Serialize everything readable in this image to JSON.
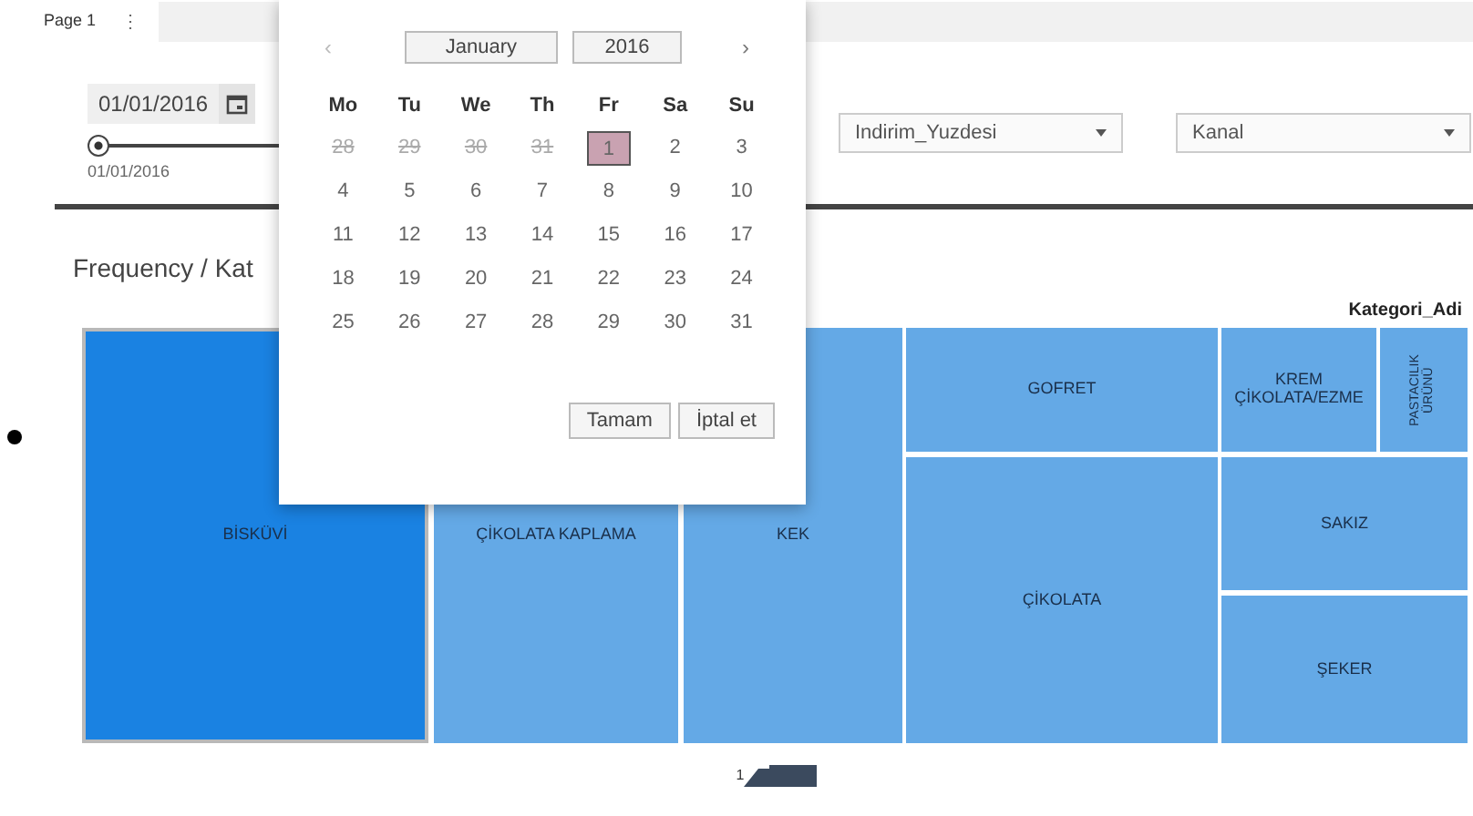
{
  "page_tab": {
    "label": "Page 1",
    "menu": "⋮"
  },
  "date_filter": {
    "value": "01/01/2016",
    "slider_label": "01/01/2016",
    "level": 0
  },
  "dropdowns": [
    {
      "value": "Indirim_Yuzdesi"
    },
    {
      "value": "Kanal"
    }
  ],
  "chart_title": "Frequency / Kat",
  "legend_title": "Kategori_Adi",
  "treemap": [
    {
      "label": "BİSKÜVİ",
      "selected": true
    },
    {
      "label": "ÇİKOLATA KAPLAMA",
      "selected": false
    },
    {
      "label": "KEK",
      "selected": false
    },
    {
      "label": "GOFRET",
      "selected": false
    },
    {
      "label": "ÇİKOLATA",
      "selected": false
    },
    {
      "label": "KREM ÇİKOLATA/EZME",
      "selected": false
    },
    {
      "label": "PASTACILIK ÜRÜNÜ",
      "selected": false,
      "vertical": true
    },
    {
      "label": "SAKIZ",
      "selected": false
    },
    {
      "label": "ŞEKER",
      "selected": false
    }
  ],
  "page_number": "1",
  "calendar": {
    "prev": "‹",
    "next": "›",
    "month": "January",
    "year": "2016",
    "weekdays": [
      "Mo",
      "Tu",
      "We",
      "Th",
      "Fr",
      "Sa",
      "Su"
    ],
    "weeks": [
      [
        {
          "day": "28",
          "outside": true,
          "selected": false
        },
        {
          "day": "29",
          "outside": true,
          "selected": false
        },
        {
          "day": "30",
          "outside": true,
          "selected": false
        },
        {
          "day": "31",
          "outside": true,
          "selected": false
        },
        {
          "day": "1",
          "outside": false,
          "selected": true
        },
        {
          "day": "2",
          "outside": false,
          "selected": false
        },
        {
          "day": "3",
          "outside": false,
          "selected": false
        }
      ],
      [
        {
          "day": "4",
          "outside": false,
          "selected": false
        },
        {
          "day": "5",
          "outside": false,
          "selected": false
        },
        {
          "day": "6",
          "outside": false,
          "selected": false
        },
        {
          "day": "7",
          "outside": false,
          "selected": false
        },
        {
          "day": "8",
          "outside": false,
          "selected": false
        },
        {
          "day": "9",
          "outside": false,
          "selected": false
        },
        {
          "day": "10",
          "outside": false,
          "selected": false
        }
      ],
      [
        {
          "day": "11",
          "outside": false,
          "selected": false
        },
        {
          "day": "12",
          "outside": false,
          "selected": false
        },
        {
          "day": "13",
          "outside": false,
          "selected": false
        },
        {
          "day": "14",
          "outside": false,
          "selected": false
        },
        {
          "day": "15",
          "outside": false,
          "selected": false
        },
        {
          "day": "16",
          "outside": false,
          "selected": false
        },
        {
          "day": "17",
          "outside": false,
          "selected": false
        }
      ],
      [
        {
          "day": "18",
          "outside": false,
          "selected": false
        },
        {
          "day": "19",
          "outside": false,
          "selected": false
        },
        {
          "day": "20",
          "outside": false,
          "selected": false
        },
        {
          "day": "21",
          "outside": false,
          "selected": false
        },
        {
          "day": "22",
          "outside": false,
          "selected": false
        },
        {
          "day": "23",
          "outside": false,
          "selected": false
        },
        {
          "day": "24",
          "outside": false,
          "selected": false
        }
      ],
      [
        {
          "day": "25",
          "outside": false,
          "selected": false
        },
        {
          "day": "26",
          "outside": false,
          "selected": false
        },
        {
          "day": "27",
          "outside": false,
          "selected": false
        },
        {
          "day": "28",
          "outside": false,
          "selected": false
        },
        {
          "day": "29",
          "outside": false,
          "selected": false
        },
        {
          "day": "30",
          "outside": false,
          "selected": false
        },
        {
          "day": "31",
          "outside": false,
          "selected": false
        }
      ]
    ],
    "buttons": [
      "Tamam",
      "İptal et"
    ]
  }
}
